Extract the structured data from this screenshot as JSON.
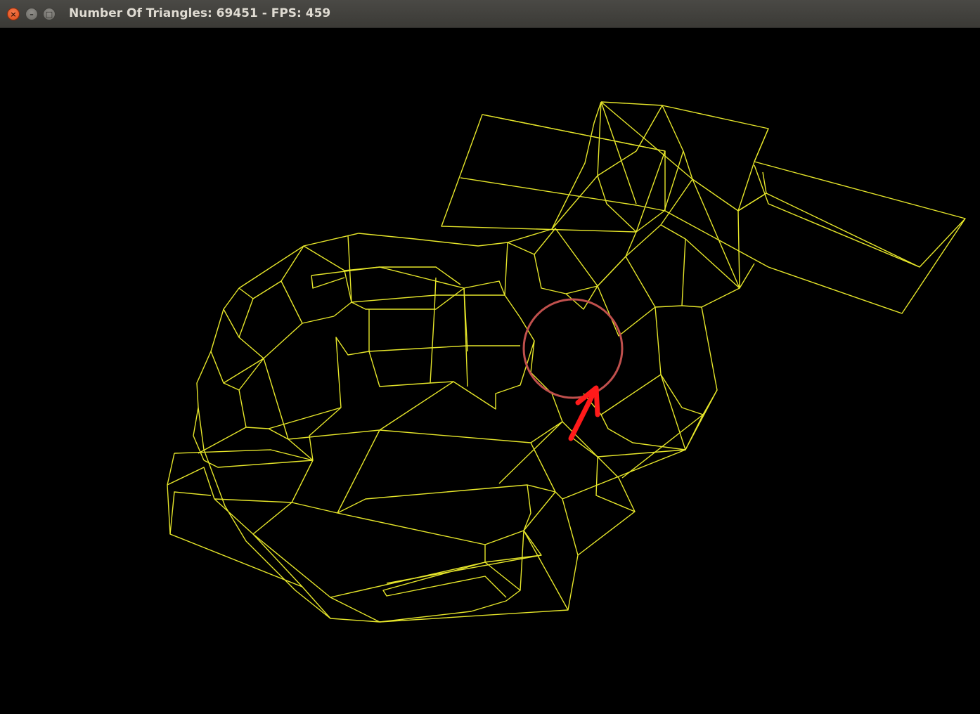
{
  "window": {
    "title": "Number Of Triangles: 69451 - FPS: 459",
    "close_icon": "close-icon",
    "minimize_icon": "minimize-icon",
    "maximize_icon": "maximize-icon"
  },
  "viewport": {
    "background": "#000000",
    "wire_color": "#e6e62a",
    "annotation_circle_color": "#c0504d",
    "annotation_arrow_color": "#ff1a1a"
  }
}
